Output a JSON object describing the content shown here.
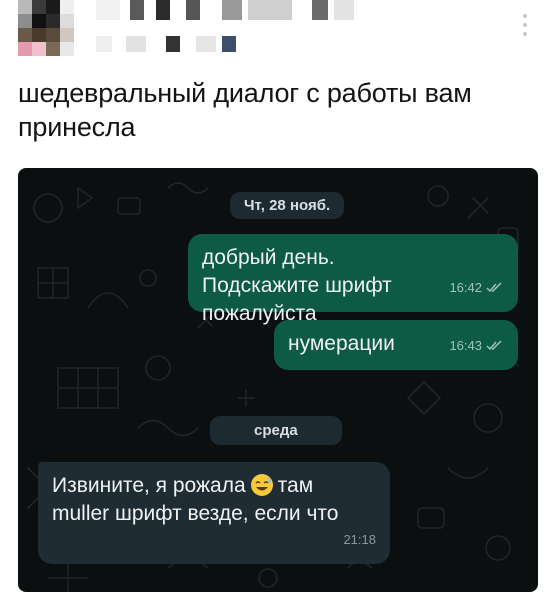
{
  "post": {
    "text": "шедевральный диалог с работы вам принесла"
  },
  "chat": {
    "date_chips": [
      "Чт, 28 нояб.",
      "среда"
    ],
    "messages": [
      {
        "direction": "outgoing",
        "text": "добрый день. Подскажите шрифт пожалуйста",
        "time": "16:42",
        "status": "read"
      },
      {
        "direction": "outgoing",
        "text": "нумерации",
        "time": "16:43",
        "status": "read"
      },
      {
        "direction": "incoming",
        "text_before_emoji": "Извините, я рожала",
        "emoji": "sweat-smile-emoji",
        "text_after_emoji": "там muller шрифт везде, если что",
        "time": "21:18"
      }
    ]
  },
  "colors": {
    "chat_background": "#0b0f10",
    "outgoing_bubble": "#0d5a45",
    "incoming_bubble": "#1f2c33",
    "read_ticks": "#7ec8e3"
  }
}
